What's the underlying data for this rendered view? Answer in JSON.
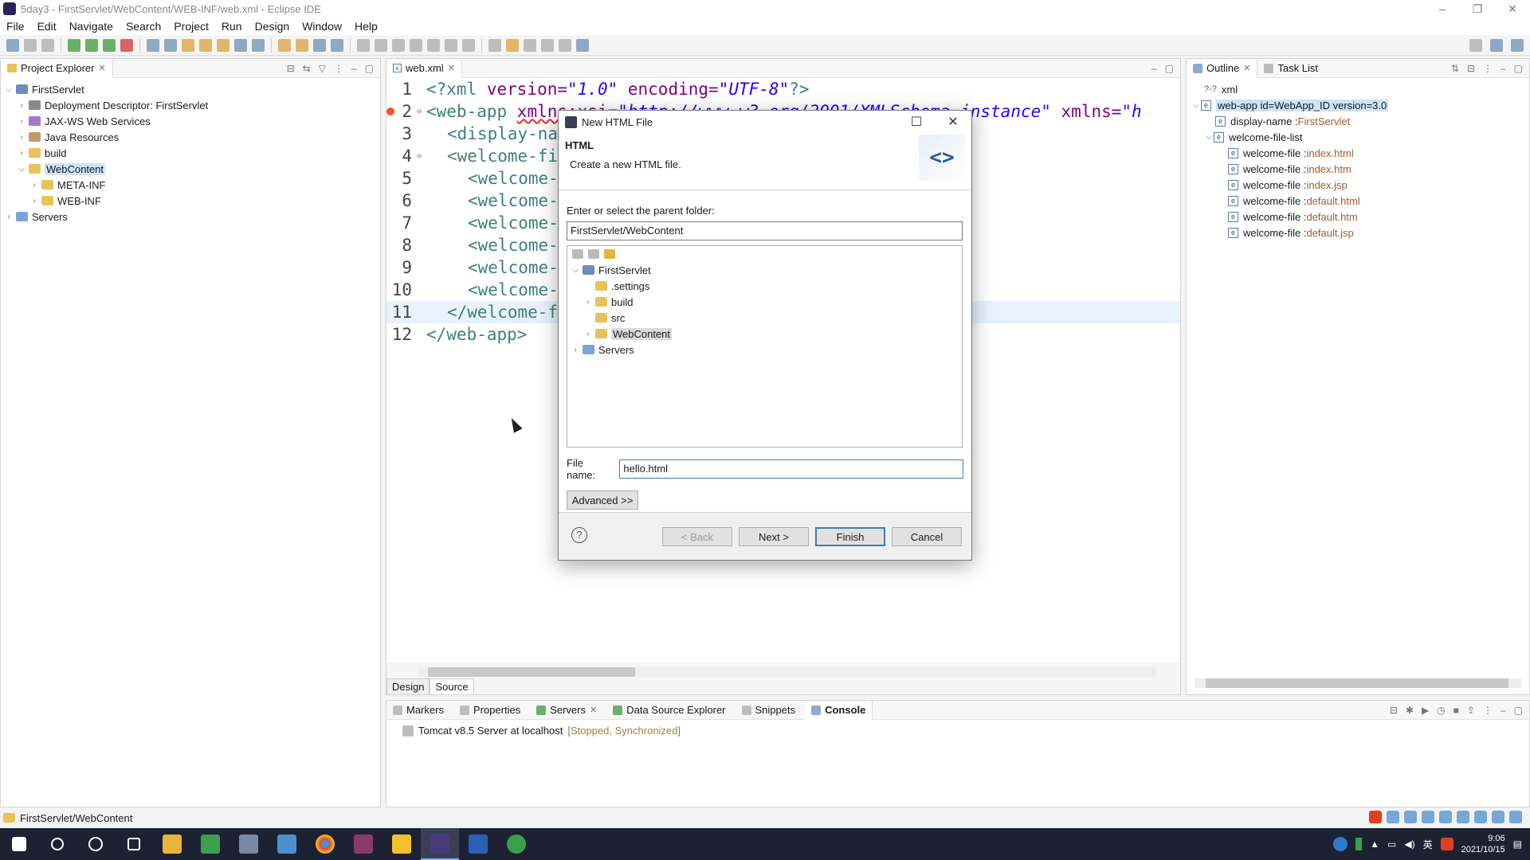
{
  "window": {
    "title": "5day3 - FirstServlet/WebContent/WEB-INF/web.xml - Eclipse IDE"
  },
  "menu": [
    "File",
    "Edit",
    "Navigate",
    "Search",
    "Project",
    "Run",
    "Design",
    "Window",
    "Help"
  ],
  "project_explorer": {
    "tab": "Project Explorer",
    "tree": {
      "project": "FirstServlet",
      "deployment": "Deployment Descriptor: FirstServlet",
      "jaxws": "JAX-WS Web Services",
      "java_resources": "Java Resources",
      "build": "build",
      "webcontent": "WebContent",
      "meta_inf": "META-INF",
      "web_inf": "WEB-INF",
      "servers": "Servers"
    }
  },
  "editor": {
    "tab": "web.xml",
    "lines": {
      "l1": {
        "tag1": "<?xml ",
        "attr1": "version=",
        "val1": "\"1.0\"",
        "attr2": " encoding=",
        "val2": "\"UTF-8\"",
        "end": "?>"
      },
      "l2": {
        "tag": "<web-app ",
        "attr": "xmlns:xsi=",
        "val": "\"http://www.w3.org/2001/XMLSchema-instance\"",
        "attr2": " xmlns=",
        "val2": "\"h"
      },
      "l3": "<display-na",
      "l4": "<welcome-fi",
      "l5": "<welcome-",
      "l6": "<welcome-",
      "l7": "<welcome-",
      "l8": "<welcome-",
      "l9": "<welcome-",
      "l10": "<welcome-",
      "l11": "</welcome-f",
      "l12": "</web-app>"
    },
    "bottom_tabs": {
      "design": "Design",
      "source": "Source"
    }
  },
  "outline": {
    "tab": "Outline",
    "tab2": "Task List",
    "xml": "xml",
    "web_app": "web-app id=WebApp_ID version=3.0",
    "display_name_label": "display-name : ",
    "display_name_value": "FirstServlet",
    "wfl": "welcome-file-list",
    "wf_label": "welcome-file : ",
    "welcome_files": [
      "index.html",
      "index.htm",
      "index.jsp",
      "default.html",
      "default.htm",
      "default.jsp"
    ]
  },
  "bottom_panel": {
    "tabs": [
      "Markers",
      "Properties",
      "Servers",
      "Data Source Explorer",
      "Snippets",
      "Console"
    ],
    "server_name": "Tomcat v8.5 Server at localhost",
    "server_status": "[Stopped, Synchronized]"
  },
  "statusbar": {
    "text": "FirstServlet/WebContent"
  },
  "dialog": {
    "title": "New HTML File",
    "heading": "HTML",
    "subtitle": "Create a new HTML file.",
    "banner_icon": "<>",
    "parent_label": "Enter or select the parent folder:",
    "parent_value": "FirstServlet/WebContent",
    "tree": {
      "root": "FirstServlet",
      "settings": ".settings",
      "build": "build",
      "src": "src",
      "webcontent": "WebContent",
      "servers": "Servers"
    },
    "filename_label": "File name:",
    "filename_value": "hello.html",
    "advanced": "Advanced >>",
    "back": "< Back",
    "next": "Next >",
    "finish": "Finish",
    "cancel": "Cancel",
    "help": "?"
  },
  "taskbar": {
    "clock_time": "9:06",
    "clock_date": "2021/10/15",
    "ime": "英"
  },
  "colors": {
    "accent": "#3c7fb1",
    "selection": "#cde3f8",
    "xml_tag": "#3f7f7f",
    "xml_attr": "#7f007f",
    "xml_string": "#2a00ff"
  }
}
